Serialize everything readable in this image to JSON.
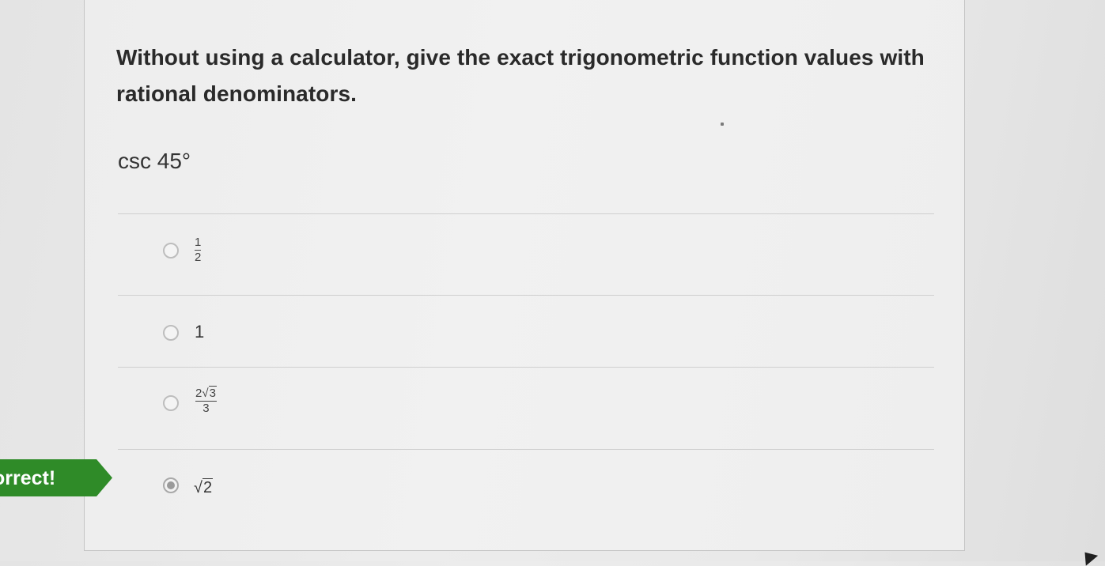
{
  "question": {
    "text": "Without using a calculator, give the exact trigonometric function values with rational denominators.",
    "prompt": "csc 45°"
  },
  "options": [
    {
      "id": "a",
      "kind": "fraction",
      "numerator": "1",
      "denominator": "2",
      "selected": false
    },
    {
      "id": "b",
      "kind": "plain",
      "label": "1",
      "selected": false
    },
    {
      "id": "c",
      "kind": "fraction-sqrt",
      "coefficient": "2",
      "radicand": "3",
      "denominator": "3",
      "selected": false
    },
    {
      "id": "d",
      "kind": "sqrt",
      "radicand": "2",
      "selected": true
    }
  ],
  "feedback": {
    "label": "orrect!",
    "color": "#2f8b28"
  },
  "icons": {
    "radical": "√",
    "cursor": "mouse-pointer-icon"
  }
}
